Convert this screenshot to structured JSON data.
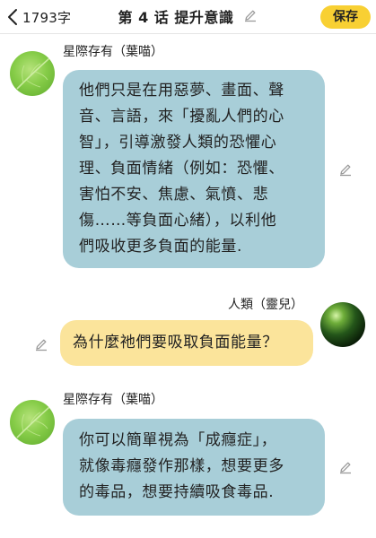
{
  "header": {
    "char_count": "1793字",
    "title": "第 4 话  提升意識",
    "save_label": "保存"
  },
  "messages": [
    {
      "sender": "星際存有（葉喵）",
      "side": "left",
      "bubble_color": "#a8ced8",
      "lines": [
        "他們只是在用惡夢、畫面、聲",
        "音、言語，來「擾亂人們的心",
        "智」，引導激發人類的恐懼心",
        "理、負面情緒（例如：恐懼、",
        "害怕不安、焦慮、氣憤、悲",
        "傷……等負面心緒），以利他",
        "們吸收更多負面的能量."
      ]
    },
    {
      "sender": "人類（靈兒）",
      "side": "right",
      "bubble_color": "#fbe49b",
      "lines": [
        "為什麼祂們要吸取負面能量？"
      ]
    },
    {
      "sender": "星際存有（葉喵）",
      "side": "left",
      "bubble_color": "#a8ced8",
      "lines": [
        "你可以簡單視為「成癮症」，",
        "就像毒癮發作那樣，想要更多",
        "的毒品，想要持續吸食毒品."
      ]
    }
  ],
  "icons": {
    "back": "chevron-left-icon",
    "title_edit": "pencil-icon",
    "message_edit": "pencil-icon"
  },
  "colors": {
    "save_button": "#f8d033",
    "bubble_character": "#a8ced8",
    "bubble_user": "#fbe49b"
  }
}
